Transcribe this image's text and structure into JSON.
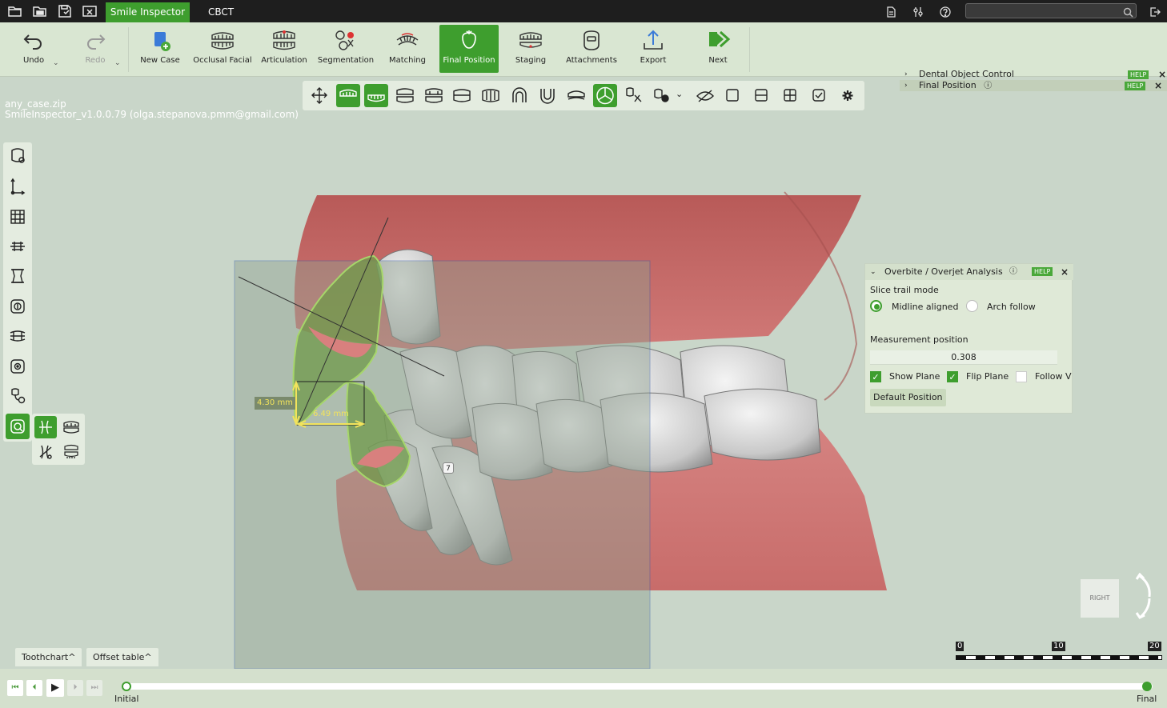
{
  "titlebar": {
    "tabs": [
      {
        "label": "Smile Inspector",
        "active": true
      },
      {
        "label": "CBCT",
        "active": false
      }
    ],
    "left_icons": [
      "open-folder-icon",
      "open-archive-icon",
      "save-icon",
      "close-case-icon"
    ],
    "right_icons": [
      "document-icon",
      "settings-sliders-icon",
      "help-icon",
      "logout-icon"
    ],
    "search": {
      "value": "",
      "placeholder": ""
    }
  },
  "ribbon": {
    "undo_label": "Undo",
    "redo_label": "Redo",
    "buttons": [
      {
        "label": "New Case",
        "icon": "new-case-icon"
      },
      {
        "label": "Occlusal Facial",
        "icon": "occlusal-facial-icon"
      },
      {
        "label": "Articulation",
        "icon": "articulation-icon"
      },
      {
        "label": "Segmentation",
        "icon": "segmentation-icon"
      },
      {
        "label": "Matching",
        "icon": "matching-icon"
      },
      {
        "label": "Final Position",
        "icon": "final-position-icon",
        "active": true
      },
      {
        "label": "Staging",
        "icon": "staging-icon"
      },
      {
        "label": "Attachments",
        "icon": "attachments-icon"
      },
      {
        "label": "Export",
        "icon": "export-icon"
      },
      {
        "label": "Next",
        "icon": "next-icon"
      }
    ]
  },
  "doc_panel": {
    "rows": [
      {
        "label": "Dental Object Control",
        "help": "HELP"
      },
      {
        "label": "Final Position",
        "help": "HELP"
      }
    ]
  },
  "file_info": {
    "filename": "any_case.zip",
    "version": "SmileInspector_v1.0.0.79 (olga.stepanova.pmm@gmail.com)"
  },
  "measurements": {
    "overjet": "4.30 mm",
    "overbite": "6.49 mm",
    "tooth_number": "7"
  },
  "overbite_panel": {
    "title": "Overbite / Overjet Analysis",
    "help": "HELP",
    "slice_trail_mode_label": "Slice trail mode",
    "options": [
      {
        "label": "Midline aligned",
        "selected": true
      },
      {
        "label": "Arch follow",
        "selected": false
      }
    ],
    "measurement_position_label": "Measurement position",
    "measurement_position_value": "0.308",
    "checkboxes": [
      {
        "label": "Show Plane",
        "checked": true
      },
      {
        "label": "Flip Plane",
        "checked": true
      },
      {
        "label": "Follow Vi",
        "checked": false
      }
    ],
    "default_button": "Default Position"
  },
  "view_cube": {
    "face": "RIGHT"
  },
  "scale_bar": {
    "ticks": [
      "0",
      "10",
      "20"
    ]
  },
  "bottom_tabs": {
    "toothchart": "Toothchart",
    "offset_table": "Offset table"
  },
  "timeline": {
    "start_label": "Initial",
    "end_label": "Final",
    "progress": 1.0
  },
  "colors": {
    "accent": "#3e9e2e",
    "gingiva": "#c87070",
    "background": "#c9d6c9",
    "selection": "#6f9a4a"
  }
}
